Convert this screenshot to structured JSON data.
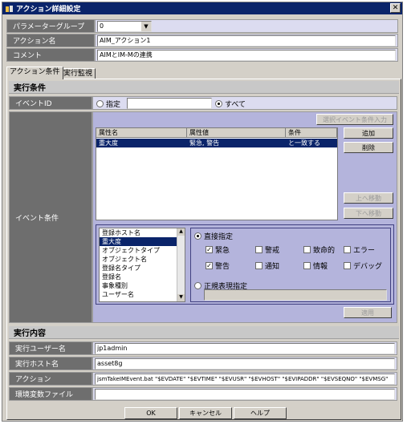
{
  "window": {
    "title": "アクション詳細設定",
    "close_glyph": "✕"
  },
  "fields": {
    "param_group": {
      "label": "パラメーターグループ",
      "value": "0"
    },
    "action_name": {
      "label": "アクション名",
      "value": "AIM_アクション1"
    },
    "comment": {
      "label": "コメント",
      "value": "AIMとIM-Mの連携"
    }
  },
  "tabs": [
    "アクション条件",
    "実行監視"
  ],
  "exec_condition": {
    "header": "実行条件",
    "event_id": {
      "label": "イベントID",
      "specify": "指定",
      "all": "すべて",
      "selected": "all"
    },
    "event_condition": {
      "label": "イベント条件",
      "selected_event_btn": "選択イベント条件入力",
      "table": {
        "columns": [
          "属性名",
          "属性値",
          "条件"
        ],
        "rows": [
          {
            "name": "重大度",
            "value": "緊急, 警告",
            "cond": "と一致する"
          }
        ]
      },
      "add_btn": "追加",
      "delete_btn": "削除",
      "up_btn": "上へ移動",
      "down_btn": "下へ移動",
      "attr_list": [
        "登録ホスト名",
        "重大度",
        "オブジェクトタイプ",
        "オブジェクト名",
        "登録名タイプ",
        "登録名",
        "事象種別",
        "ユーザー名"
      ],
      "attr_selected_index": 1,
      "direct": {
        "label": "直接指定",
        "checks": [
          {
            "label": "緊急",
            "checked": true
          },
          {
            "label": "警戒",
            "checked": false
          },
          {
            "label": "致命的",
            "checked": false
          },
          {
            "label": "エラー",
            "checked": false
          },
          {
            "label": "警告",
            "checked": true
          },
          {
            "label": "通知",
            "checked": false
          },
          {
            "label": "情報",
            "checked": false
          },
          {
            "label": "デバッグ",
            "checked": false
          }
        ]
      },
      "regex": {
        "label": "正規表現指定",
        "value": ""
      },
      "apply_btn": "適用"
    }
  },
  "exec_content": {
    "header": "実行内容",
    "exec_user": {
      "label": "実行ユーザー名",
      "value": "jp1admin"
    },
    "exec_host": {
      "label": "実行ホスト名",
      "value": "asset8g"
    },
    "action": {
      "label": "アクション",
      "value": "jsmTakeIMEvent.bat \"$EVDATE\" \"$EVTIME\" \"$EVUSR\" \"$EVHOST\" \"$EVIPADDR\" \"$EVSEQNO\" \"$EVMSG\""
    },
    "env_file": {
      "label": "環境変数ファイル",
      "value": ""
    }
  },
  "footer": {
    "ok": "OK",
    "cancel": "キャンセル",
    "help": "ヘルプ"
  }
}
